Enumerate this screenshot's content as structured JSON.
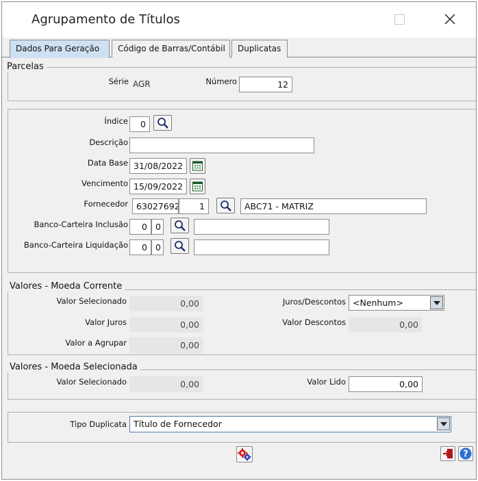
{
  "window": {
    "title": "Agrupamento de Títulos"
  },
  "tabs": [
    {
      "label": "Dados Para Geração",
      "active": true
    },
    {
      "label": "Código de Barras/Contábil",
      "active": false
    },
    {
      "label": "Duplicatas",
      "active": false
    }
  ],
  "parcelas": {
    "title": "Parcelas",
    "serie_label": "Série",
    "serie_value": "AGR",
    "numero_label": "Número",
    "numero_value": "12"
  },
  "form": {
    "indice_label": "Índice",
    "indice_value": "0",
    "descricao_label": "Descrição",
    "descricao_value": "",
    "data_base_label": "Data Base",
    "data_base_value": "31/08/2022",
    "vencimento_label": "Vencimento",
    "vencimento_value": "15/09/2022",
    "fornecedor_label": "Fornecedor",
    "fornecedor_code": "63027692",
    "fornecedor_seq": "1",
    "fornecedor_name": "ABC71 - MATRIZ",
    "banco_inclusao_label": "Banco-Carteira Inclusão",
    "banco_inclusao_a": "0",
    "banco_inclusao_b": "0",
    "banco_inclusao_desc": "",
    "banco_liquidacao_label": "Banco-Carteira Liquidação",
    "banco_liquidacao_a": "0",
    "banco_liquidacao_b": "0",
    "banco_liquidacao_desc": ""
  },
  "moeda_corrente": {
    "title": "Valores - Moeda Corrente",
    "valor_selecionado_label": "Valor Selecionado",
    "valor_selecionado": "0,00",
    "valor_juros_label": "Valor Juros",
    "valor_juros": "0,00",
    "valor_agrupar_label": "Valor a Agrupar",
    "valor_agrupar": "0,00",
    "juros_descontos_label": "Juros/Descontos",
    "juros_descontos_value": "<Nenhum>",
    "valor_descontos_label": "Valor Descontos",
    "valor_descontos": "0,00"
  },
  "moeda_selecionada": {
    "title": "Valores - Moeda Selecionada",
    "valor_selecionado_label": "Valor Selecionado",
    "valor_selecionado": "0,00",
    "valor_lido_label": "Valor Lido",
    "valor_lido": "0,00"
  },
  "tipo": {
    "label": "Tipo Duplicata",
    "value": "Título de Fornecedor"
  },
  "colors": {
    "tab_active": "#cfe0f2",
    "window_bg": "#f0f0f0",
    "readonly_bg": "#e6e6e6"
  }
}
